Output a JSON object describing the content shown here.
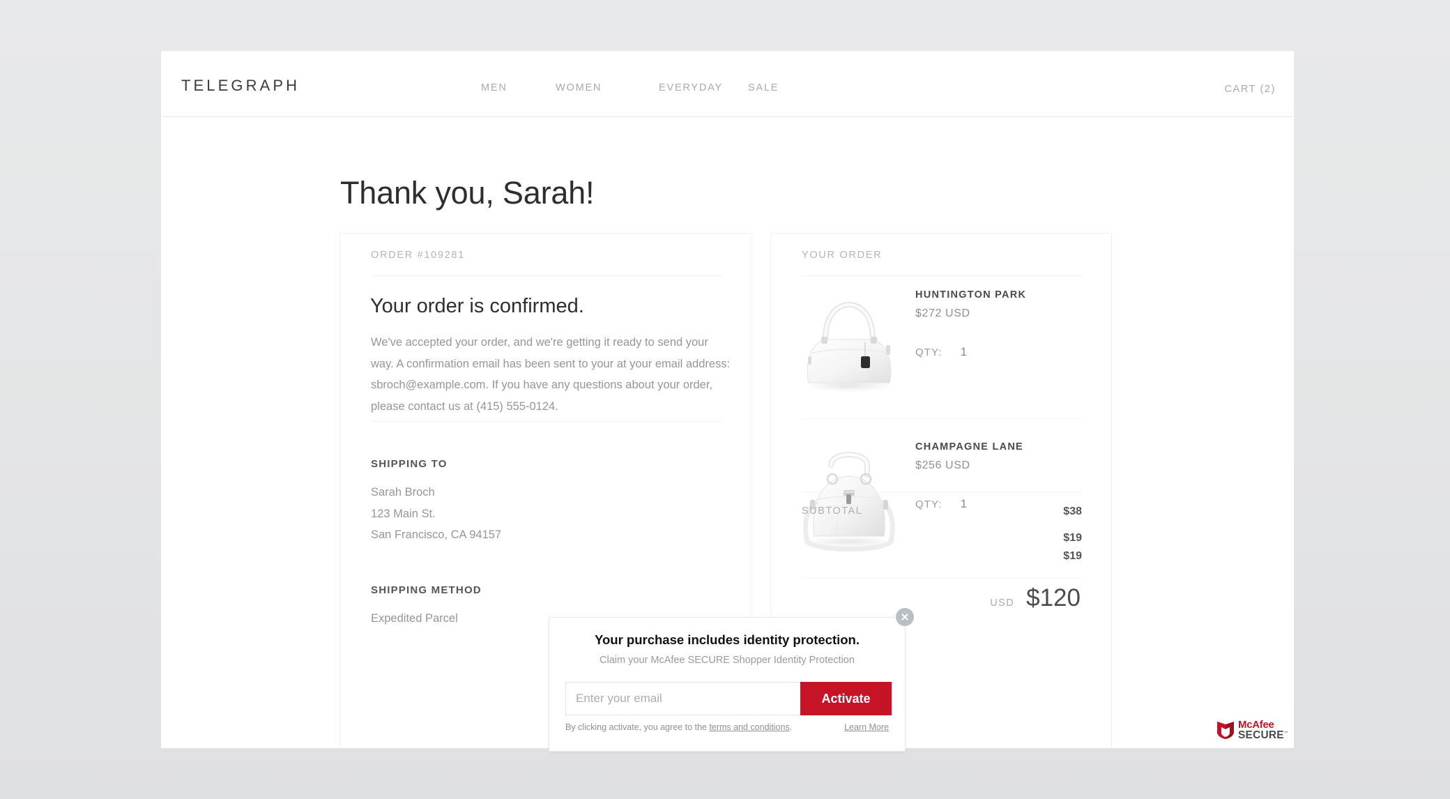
{
  "header": {
    "brand": "TELEGRAPH",
    "nav": [
      {
        "label": "MEN"
      },
      {
        "label": "WOMEN"
      },
      {
        "label": "EVERYDAY"
      },
      {
        "label": "SALE"
      }
    ],
    "cart_label": "CART (2)"
  },
  "page": {
    "title": "Thank you, Sarah!"
  },
  "order_card": {
    "eyebrow": "ORDER #109281",
    "heading": "Your order is confirmed.",
    "body": "We've accepted your order, and we're getting it ready to send your way. A confirmation email has been sent to your at your email address: sbroch@example.com. If you have any questions about your order, please contact us at (415) 555-0124.",
    "shipping_to_label": "SHIPPING TO",
    "shipping_to": "Sarah Broch\n123 Main St.\nSan Francisco, CA 94157",
    "shipping_method_label": "SHIPPING METHOD",
    "shipping_method": "Expedited Parcel"
  },
  "summary_card": {
    "eyebrow": "YOUR ORDER",
    "products": [
      {
        "name": "HUNTINGTON PARK",
        "price": "$272 USD",
        "qty_label": "QTY:",
        "qty": "1"
      },
      {
        "name": "CHAMPAGNE LANE",
        "price": "$256 USD",
        "qty_label": "QTY:",
        "qty": "1"
      }
    ],
    "totals": [
      {
        "label": "SUBTOTAL",
        "value": "$38"
      },
      {
        "label": "",
        "value": "$19"
      },
      {
        "label": "",
        "value": "$19"
      }
    ],
    "grand_total": {
      "currency": "USD",
      "amount": "$120"
    }
  },
  "mcafee_popup": {
    "title": "Your purchase includes identity protection.",
    "subtitle": "Claim your McAfee SECURE Shopper Identity Protection",
    "email_placeholder": "Enter your email",
    "email_value": "",
    "activate_label": "Activate",
    "terms_prefix": "By clicking activate, you agree to the ",
    "terms_link": "terms and conditions",
    "terms_suffix": ".",
    "learn_more": "Learn More",
    "accent_color": "#c41425"
  },
  "trust_badge": {
    "brand": "McAfee",
    "word": "SECURE",
    "tm": "™"
  }
}
